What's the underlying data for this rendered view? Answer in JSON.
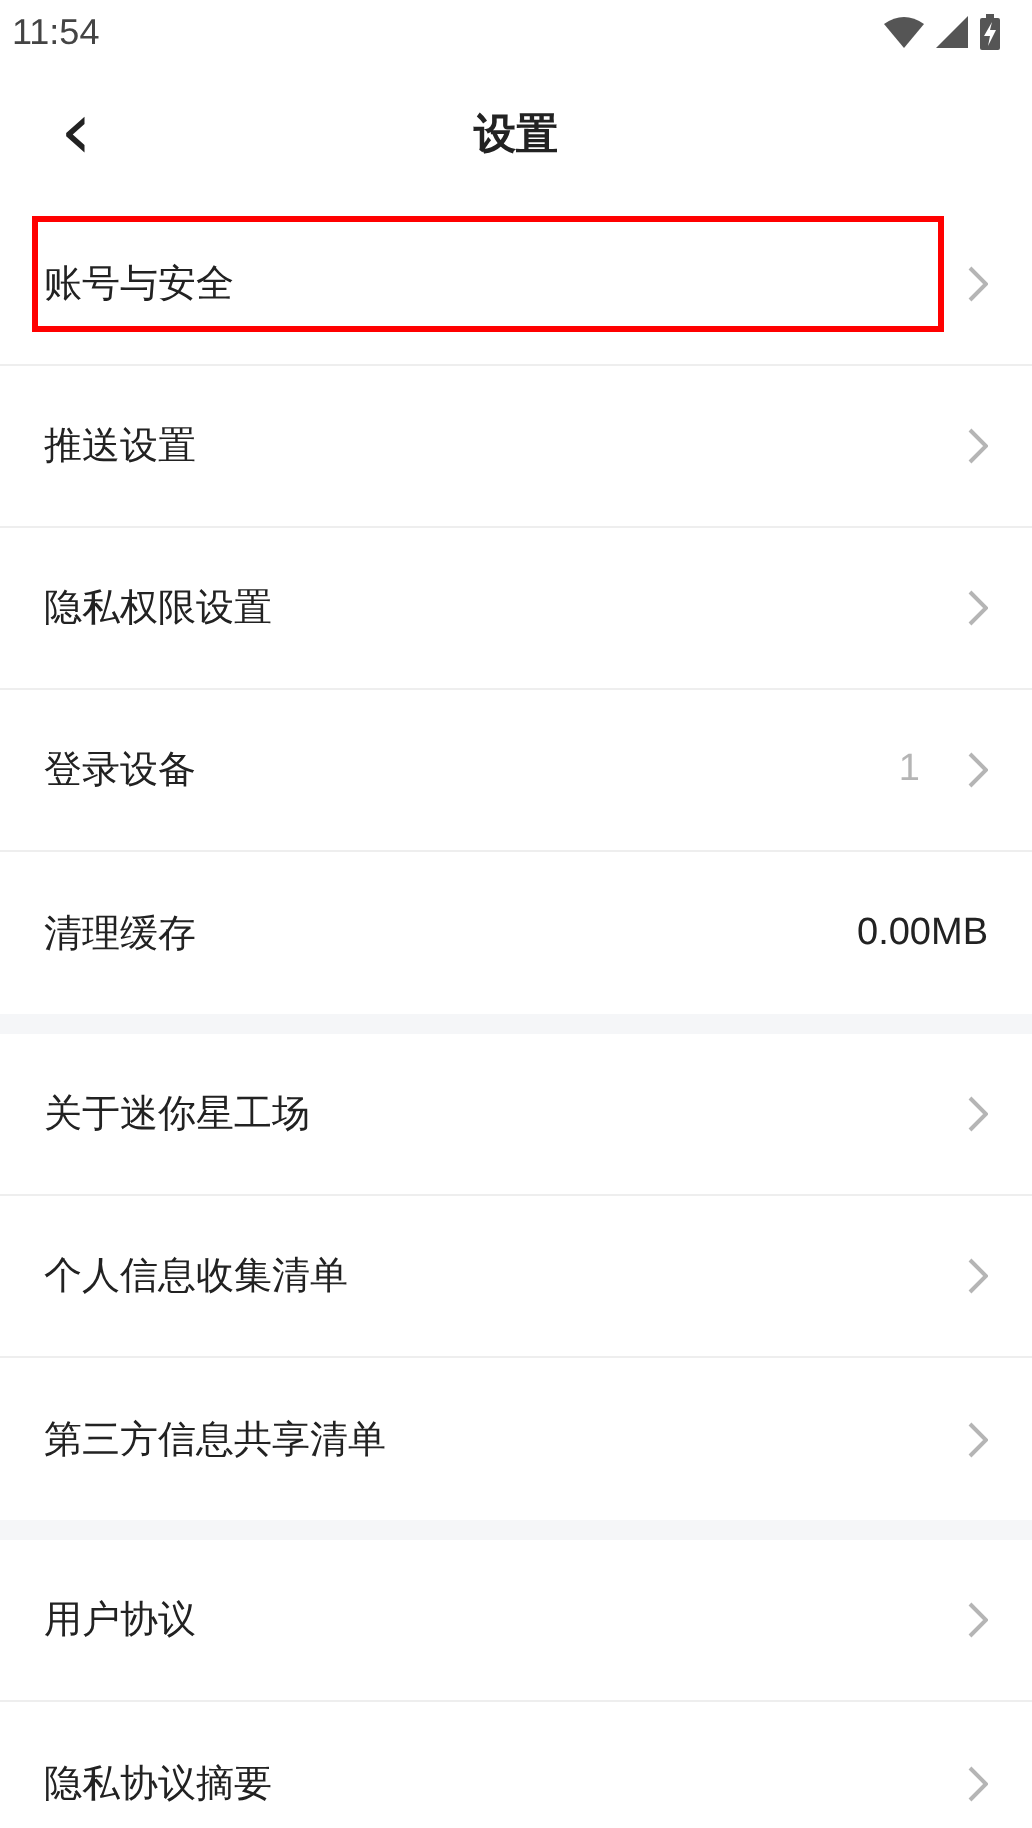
{
  "status_bar": {
    "time": "11:54"
  },
  "header": {
    "back": "‹",
    "title": "设置"
  },
  "groups": [
    {
      "items": [
        {
          "label": "账号与安全",
          "chevron": true,
          "highlighted": true
        },
        {
          "label": "推送设置",
          "chevron": true,
          "highlighted": false
        },
        {
          "label": "隐私权限设置",
          "chevron": true,
          "highlighted": false
        },
        {
          "label": "登录设备",
          "value": "1",
          "value_muted": true,
          "chevron": true,
          "highlighted": false
        },
        {
          "label": "清理缓存",
          "value": "0.00MB",
          "value_muted": false,
          "chevron": false,
          "highlighted": false
        }
      ]
    },
    {
      "items": [
        {
          "label": "关于迷你星工场",
          "chevron": true,
          "highlighted": false
        },
        {
          "label": "个人信息收集清单",
          "chevron": true,
          "highlighted": false
        },
        {
          "label": "第三方信息共享清单",
          "chevron": true,
          "highlighted": false
        }
      ]
    },
    {
      "items": [
        {
          "label": "用户协议",
          "chevron": true,
          "highlighted": false
        },
        {
          "label": "隐私协议摘要",
          "chevron": true,
          "highlighted": false
        }
      ]
    }
  ]
}
